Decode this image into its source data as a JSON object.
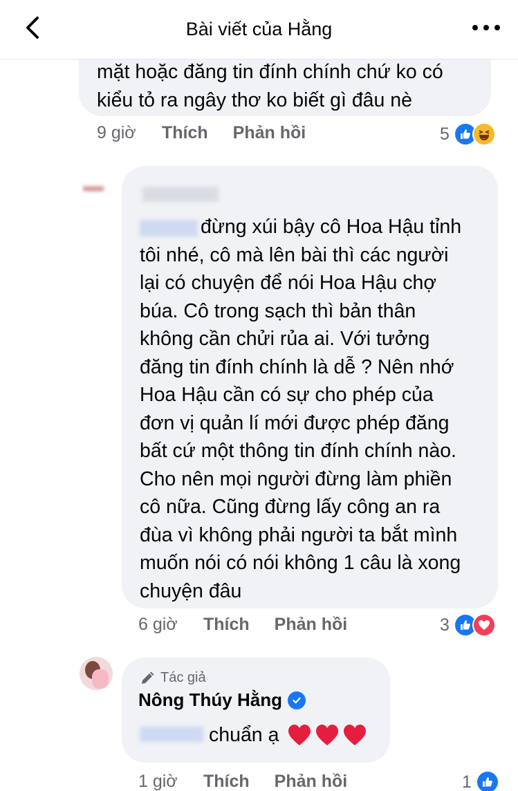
{
  "header": {
    "title": "Bài viết của Hằng"
  },
  "comments": [
    {
      "lines": [
        "mặt hoặc đăng tin đính chính chứ ko có",
        "kiểu tỏ ra ngây thơ ko biết gì đâu nè"
      ],
      "time": "9 giờ",
      "like_label": "Thích",
      "reply_label": "Phản hồi",
      "reaction_count": "5",
      "reactions": [
        "like",
        "haha"
      ]
    },
    {
      "lines": [
        "đừng xúi bậy cô Hoa Hậu tỉnh",
        "tôi nhé, cô mà lên bài thì các người",
        "lại có chuyện để nói Hoa Hậu chợ",
        "búa. Cô trong sạch thì bản thân",
        "không cần chửi rủa ai. Với tưởng",
        "đăng tin đính chính là dễ ? Nên nhớ",
        "Hoa Hậu cần có sự cho phép của",
        "đơn vị quản lí mới được phép đăng",
        "bất cứ một thông tin đính chính nào.",
        "Cho nên mọi người đừng làm phiền",
        "cô nữa. Cũng đừng lấy công an ra",
        "đùa vì không phải người ta bắt mình",
        "muốn nói có nói không 1 câu là xong",
        "chuyện đâu"
      ],
      "time": "6 giờ",
      "like_label": "Thích",
      "reply_label": "Phản hồi",
      "reaction_count": "3",
      "reactions": [
        "like",
        "love"
      ]
    },
    {
      "author_tag": "Tác giả",
      "author_name": "Nông Thúy Hằng",
      "text": "chuẩn ạ",
      "time": "1 giờ",
      "like_label": "Thích",
      "reply_label": "Phản hồi",
      "reaction_count": "1",
      "reactions": [
        "like"
      ]
    }
  ],
  "colors": {
    "like": "#1877f2",
    "love": "#f33e58",
    "haha": "#f7b928",
    "heart": "#e41e3f",
    "bubble": "#f0f2f5",
    "meta": "#65676b"
  },
  "icons": [
    "chevron-left-icon",
    "more-icon",
    "like-icon",
    "haha-icon",
    "love-icon",
    "pencil-icon",
    "verified-icon",
    "heart-icon"
  ]
}
